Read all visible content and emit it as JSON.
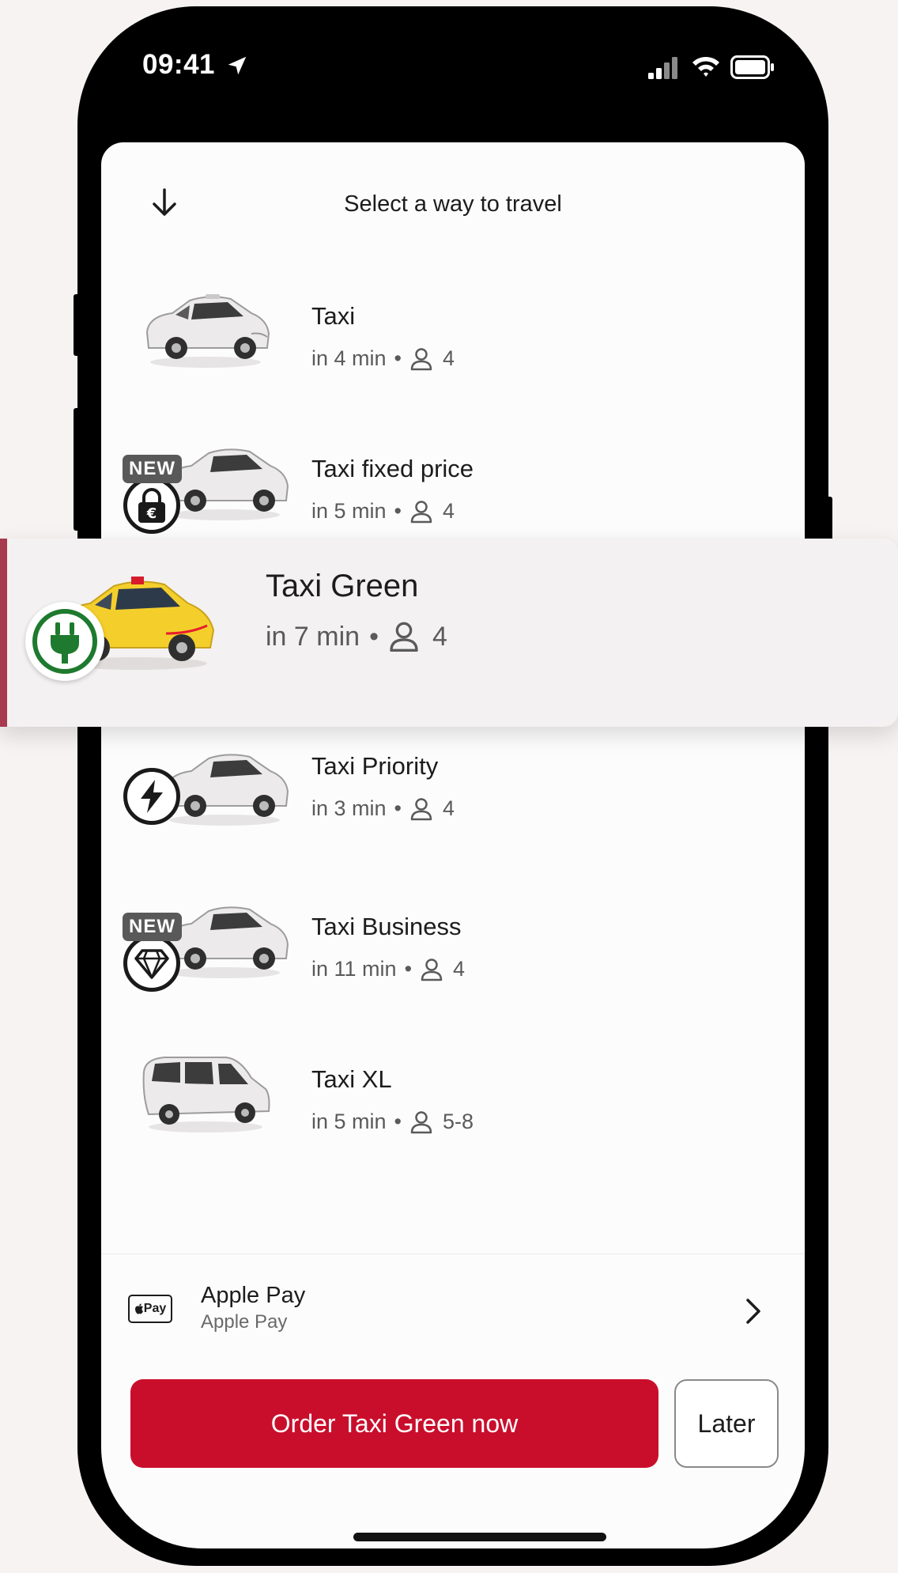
{
  "status_bar": {
    "time": "09:41"
  },
  "header": {
    "title": "Select a way to travel"
  },
  "rides": [
    {
      "name": "Taxi",
      "eta": "in 4 min",
      "capacity": "4",
      "badge": "",
      "new_label": ""
    },
    {
      "name": "Taxi fixed price",
      "eta": "in 5 min",
      "capacity": "4",
      "badge": "euro-lock-icon",
      "new_label": "NEW"
    },
    {
      "name": "Taxi Green",
      "eta": "in 7 min",
      "capacity": "4",
      "badge": "plug-icon",
      "new_label": "",
      "selected": true
    },
    {
      "name": "Taxi Priority",
      "eta": "in 3 min",
      "capacity": "4",
      "badge": "lightning-icon",
      "new_label": ""
    },
    {
      "name": "Taxi Business",
      "eta": "in 11 min",
      "capacity": "4",
      "badge": "diamond-icon",
      "new_label": "NEW"
    },
    {
      "name": "Taxi XL",
      "eta": "in 5 min",
      "capacity": "5-8",
      "badge": "",
      "new_label": ""
    }
  ],
  "payment": {
    "logo_text": "Pay",
    "method": "Apple Pay",
    "sub": "Apple Pay"
  },
  "actions": {
    "order_label": "Order Taxi Green now",
    "later_label": "Later"
  },
  "colors": {
    "accent": "#c90e2c",
    "selected_bar": "#a73a4f",
    "green_badge": "#1e7a2e",
    "taxi_yellow": "#f4cf2c"
  }
}
